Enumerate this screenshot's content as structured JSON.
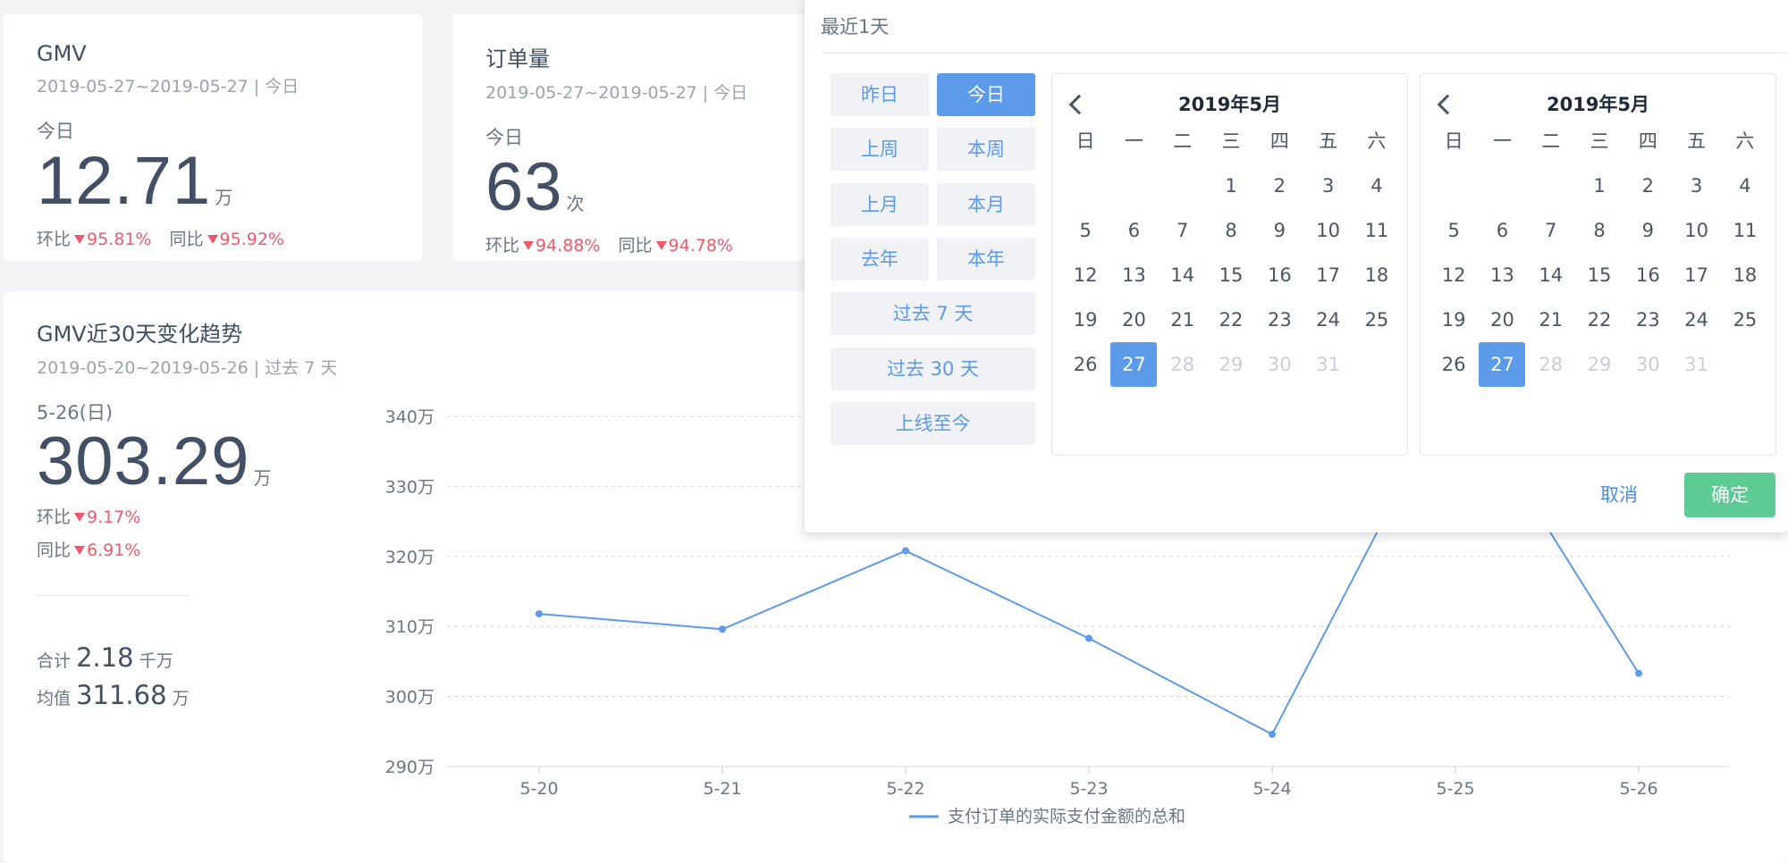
{
  "cards": [
    {
      "title": "GMV",
      "date": "2019-05-27~2019-05-27 | 今日",
      "period": "今日",
      "value": "12.71",
      "unit": "万",
      "hb_label": "环比",
      "hb": "95.81%",
      "tb_label": "同比",
      "tb": "95.92%"
    },
    {
      "title": "订单量",
      "date": "2019-05-27~2019-05-27 | 今日",
      "period": "今日",
      "value": "63",
      "unit": "次",
      "hb_label": "环比",
      "hb": "94.88%",
      "tb_label": "同比",
      "tb": "94.78%"
    }
  ],
  "trend": {
    "title": "GMV近30天变化趋势",
    "date": "2019-05-20~2019-05-26 | 过去 7 天",
    "day": "5-26(日)",
    "value": "303.29",
    "unit": "万",
    "hb_label": "环比",
    "hb": "9.17%",
    "tb_label": "同比",
    "tb": "6.91%",
    "sum_label": "合计",
    "sum_value": "2.18",
    "sum_unit": "千万",
    "avg_label": "均值",
    "avg_value": "311.68",
    "avg_unit": "万"
  },
  "chart_data": {
    "type": "line",
    "categories": [
      "5-20",
      "5-21",
      "5-22",
      "5-23",
      "5-24",
      "5-25",
      "5-26"
    ],
    "series": [
      {
        "name": "支付订单的实际支付金额的总和",
        "values": [
          311.8,
          309.6,
          320.8,
          308.3,
          294.6,
          345.0,
          303.3
        ]
      }
    ],
    "yticks": [
      "290万",
      "300万",
      "310万",
      "320万",
      "330万",
      "340万"
    ],
    "ylim": [
      290,
      340
    ],
    "color": "#5b9bea",
    "grid": true,
    "legend": "bottom"
  },
  "picker": {
    "header": "最近1天",
    "quick": {
      "yesterday": "昨日",
      "today": "今日",
      "last_week": "上周",
      "this_week": "本周",
      "last_month": "上月",
      "this_month": "本月",
      "last_year": "去年",
      "this_year": "本年",
      "past7": "过去 7 天",
      "past30": "过去 30 天",
      "since_launch": "上线至今"
    },
    "left_month": "2019年5月",
    "right_month": "2019年5月",
    "weekdays": [
      "日",
      "一",
      "二",
      "三",
      "四",
      "五",
      "六"
    ],
    "cancel": "取消",
    "ok": "确定"
  }
}
